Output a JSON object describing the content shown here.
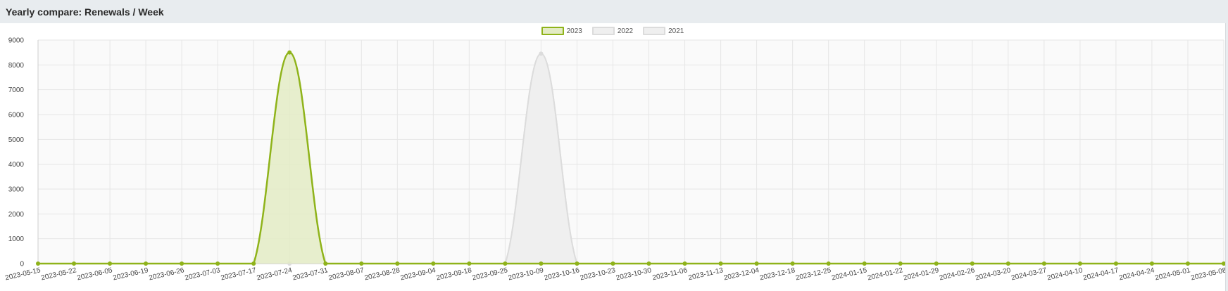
{
  "panel": {
    "title": "Yearly compare: Renewals / Week"
  },
  "colors": {
    "series_2023_line": "#8fb31a",
    "series_2023_fill": "#e3ebc4",
    "series_other_line": "#dcdcdc",
    "series_other_fill": "#efefef",
    "grid": "#e6e6e6",
    "plot_bg": "#fafafa",
    "axis_text": "#444444"
  },
  "chart_data": {
    "type": "area",
    "title": "Yearly compare: Renewals / Week",
    "xlabel": "",
    "ylabel": "",
    "ylim": [
      0,
      9000
    ],
    "yticks": [
      0,
      1000,
      2000,
      3000,
      4000,
      5000,
      6000,
      7000,
      8000,
      9000
    ],
    "grid": true,
    "legend_position": "top-center",
    "categories": [
      "2023-05-15",
      "2023-05-22",
      "2023-06-05",
      "2023-06-19",
      "2023-06-26",
      "2023-07-03",
      "2023-07-17",
      "2023-07-24",
      "2023-07-31",
      "2023-08-07",
      "2023-08-28",
      "2023-09-04",
      "2023-09-18",
      "2023-09-25",
      "2023-10-09",
      "2023-10-16",
      "2023-10-23",
      "2023-10-30",
      "2023-11-06",
      "2023-11-13",
      "2023-12-04",
      "2023-12-18",
      "2023-12-25",
      "2024-01-15",
      "2024-01-22",
      "2024-01-29",
      "2024-02-26",
      "2024-03-20",
      "2024-03-27",
      "2024-04-10",
      "2024-04-17",
      "2024-04-24",
      "2024-05-01",
      "2023-05-08"
    ],
    "series": [
      {
        "name": "2023",
        "values": [
          0,
          0,
          0,
          0,
          0,
          0,
          0,
          8500,
          0,
          0,
          0,
          0,
          0,
          0,
          0,
          0,
          0,
          0,
          0,
          0,
          0,
          0,
          0,
          0,
          0,
          0,
          0,
          0,
          0,
          0,
          0,
          0,
          0,
          0
        ]
      },
      {
        "name": "2022",
        "values": [
          0,
          0,
          0,
          0,
          0,
          0,
          0,
          0,
          0,
          0,
          0,
          0,
          0,
          0,
          8450,
          0,
          0,
          0,
          0,
          0,
          0,
          0,
          0,
          0,
          0,
          0,
          0,
          0,
          0,
          0,
          0,
          0,
          0,
          0
        ]
      },
      {
        "name": "2021",
        "values": [
          0,
          0,
          0,
          0,
          0,
          0,
          0,
          0,
          0,
          0,
          0,
          0,
          0,
          0,
          8450,
          0,
          0,
          0,
          0,
          0,
          0,
          0,
          0,
          0,
          0,
          0,
          0,
          0,
          0,
          0,
          0,
          0,
          0,
          0
        ]
      }
    ]
  }
}
